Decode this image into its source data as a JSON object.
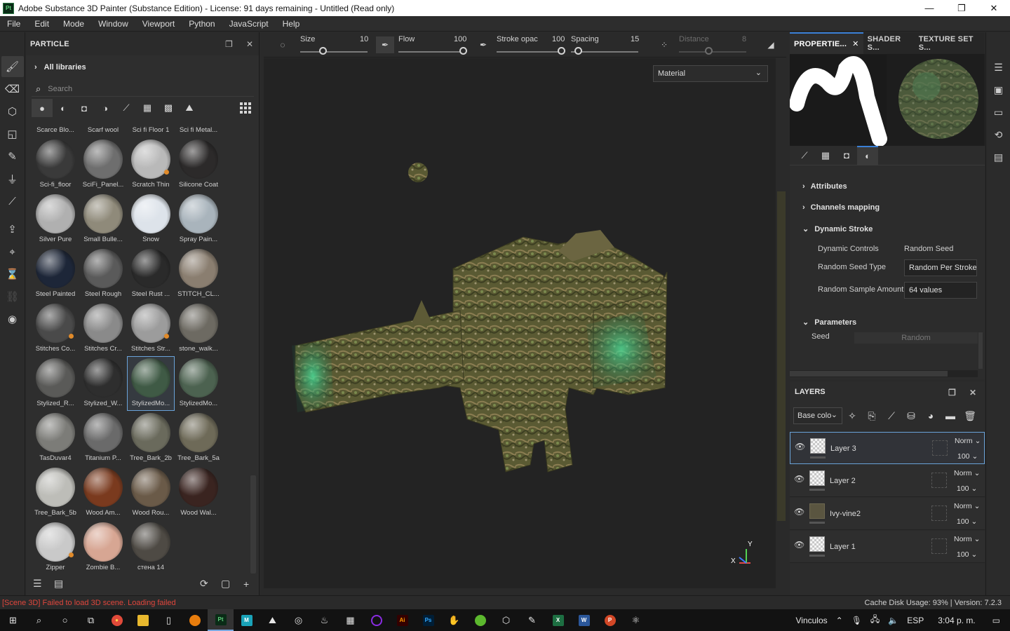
{
  "window": {
    "app_icon": "Pt",
    "title": "Adobe Substance 3D Painter (Substance Edition) - License: 91 days remaining - Untitled (Read only)",
    "minimize": "—",
    "maximize": "❐",
    "close": "✕"
  },
  "menu": [
    "File",
    "Edit",
    "Mode",
    "Window",
    "Viewport",
    "Python",
    "JavaScript",
    "Help"
  ],
  "shelf": {
    "title": "PARTICLE",
    "libraries": "All libraries",
    "search_placeholder": "Search",
    "top_labels": [
      "Scarce Blo...",
      "Scarf wool",
      "Sci fi Floor 1",
      "Sci fi Metal..."
    ],
    "materials": [
      {
        "label": "Sci-fi_floor",
        "color": "#3a3a3a",
        "dot": ""
      },
      {
        "label": "SciFi_Panel...",
        "color": "#6e6e6e",
        "dot": ""
      },
      {
        "label": "Scratch Thin",
        "color": "#b9b9b9",
        "dot": "#e08a2a"
      },
      {
        "label": "Silicone Coat",
        "color": "#2c2a2a",
        "dot": ""
      },
      {
        "label": "Silver Pure",
        "color": "#b0b0b0",
        "dot": ""
      },
      {
        "label": "Small Bulle...",
        "color": "#8f8a7a",
        "dot": ""
      },
      {
        "label": "Snow",
        "color": "#dde3ea",
        "dot": ""
      },
      {
        "label": "Spray Pain...",
        "color": "#a9b4bc",
        "dot": ""
      },
      {
        "label": "Steel Painted",
        "color": "#1d2638",
        "dot": ""
      },
      {
        "label": "Steel Rough",
        "color": "#5a5a5a",
        "dot": ""
      },
      {
        "label": "Steel Rust ...",
        "color": "#2a2a2a",
        "dot": ""
      },
      {
        "label": "STITCH_CL...",
        "color": "#8a7e70",
        "dot": ""
      },
      {
        "label": "Stitches Co...",
        "color": "#4a4a4a",
        "dot": "#e08a2a"
      },
      {
        "label": "Stitches Cr...",
        "color": "#8a8a8a",
        "dot": ""
      },
      {
        "label": "Stitches Str...",
        "color": "#9c9c9c",
        "dot": "#e08a2a"
      },
      {
        "label": "stone_walk...",
        "color": "#6d6a62",
        "dot": ""
      },
      {
        "label": "Stylized_R...",
        "color": "#5a5a58",
        "dot": ""
      },
      {
        "label": "Stylized_W...",
        "color": "#2e2e2e",
        "dot": ""
      },
      {
        "label": "StylizedMo...",
        "color": "#3f5a45",
        "dot": "",
        "selected": true
      },
      {
        "label": "StylizedMo...",
        "color": "#4c6250",
        "dot": ""
      },
      {
        "label": "TasDuvar4",
        "color": "#7c7c78",
        "dot": ""
      },
      {
        "label": "Titanium P...",
        "color": "#6a6a6a",
        "dot": ""
      },
      {
        "label": "Tree_Bark_2b",
        "color": "#6a6a5c",
        "dot": ""
      },
      {
        "label": "Tree_Bark_5a",
        "color": "#6e6a58",
        "dot": ""
      },
      {
        "label": "Tree_Bark_5b",
        "color": "#bdbdb8",
        "dot": ""
      },
      {
        "label": "Wood Am...",
        "color": "#7a3a1e",
        "dot": ""
      },
      {
        "label": "Wood Rou...",
        "color": "#6a5a48",
        "dot": ""
      },
      {
        "label": "Wood Wal...",
        "color": "#3a2420",
        "dot": ""
      },
      {
        "label": "Zipper",
        "color": "#c9c9c9",
        "dot": "#e08a2a"
      },
      {
        "label": "Zombie B...",
        "color": "#d7a693",
        "dot": ""
      },
      {
        "label": "стена 14",
        "color": "#4e4a44",
        "dot": ""
      }
    ]
  },
  "ctx": {
    "size_label": "Size",
    "size_value": "10",
    "flow_label": "Flow",
    "flow_value": "100",
    "stroke_label": "Stroke opac",
    "stroke_value": "100",
    "spacing_label": "Spacing",
    "spacing_value": "15",
    "distance_label": "Distance",
    "distance_value": "8"
  },
  "viewport": {
    "mode_select": "Material",
    "axis_y": "Y",
    "axis_x": "X"
  },
  "properties": {
    "tabs": [
      "PROPERTIE...",
      "SHADER S...",
      "TEXTURE SET S..."
    ],
    "sections": {
      "attributes": "Attributes",
      "channels": "Channels mapping",
      "dynamic": "Dynamic Stroke",
      "parameters": "Parameters"
    },
    "dynamic_controls_label": "Dynamic Controls",
    "dynamic_controls_value": "Random Seed",
    "seed_type_label": "Random Seed Type",
    "seed_type_value": "Random Per Stroke",
    "sample_label": "Random Sample Amount",
    "sample_value": "64 values",
    "seed_label": "Seed",
    "seed_value": "Random"
  },
  "layers": {
    "title": "LAYERS",
    "channel_select": "Base colo",
    "items": [
      {
        "name": "Layer 3",
        "blend": "Norm",
        "opacity": "100",
        "selected": true
      },
      {
        "name": "Layer 2",
        "blend": "Norm",
        "opacity": "100"
      },
      {
        "name": "Ivy-vine2",
        "blend": "Norm",
        "opacity": "100",
        "folder": true
      },
      {
        "name": "Layer 1",
        "blend": "Norm",
        "opacity": "100"
      }
    ]
  },
  "status": {
    "error": "[Scene 3D] Failed to load 3D scene. Loading failed",
    "cache": "Cache Disk Usage:   93% | Version: 7.2.3"
  },
  "taskbar": {
    "tray_label": "Vinculos",
    "lang": "ESP",
    "time": "3:04 p. m."
  }
}
